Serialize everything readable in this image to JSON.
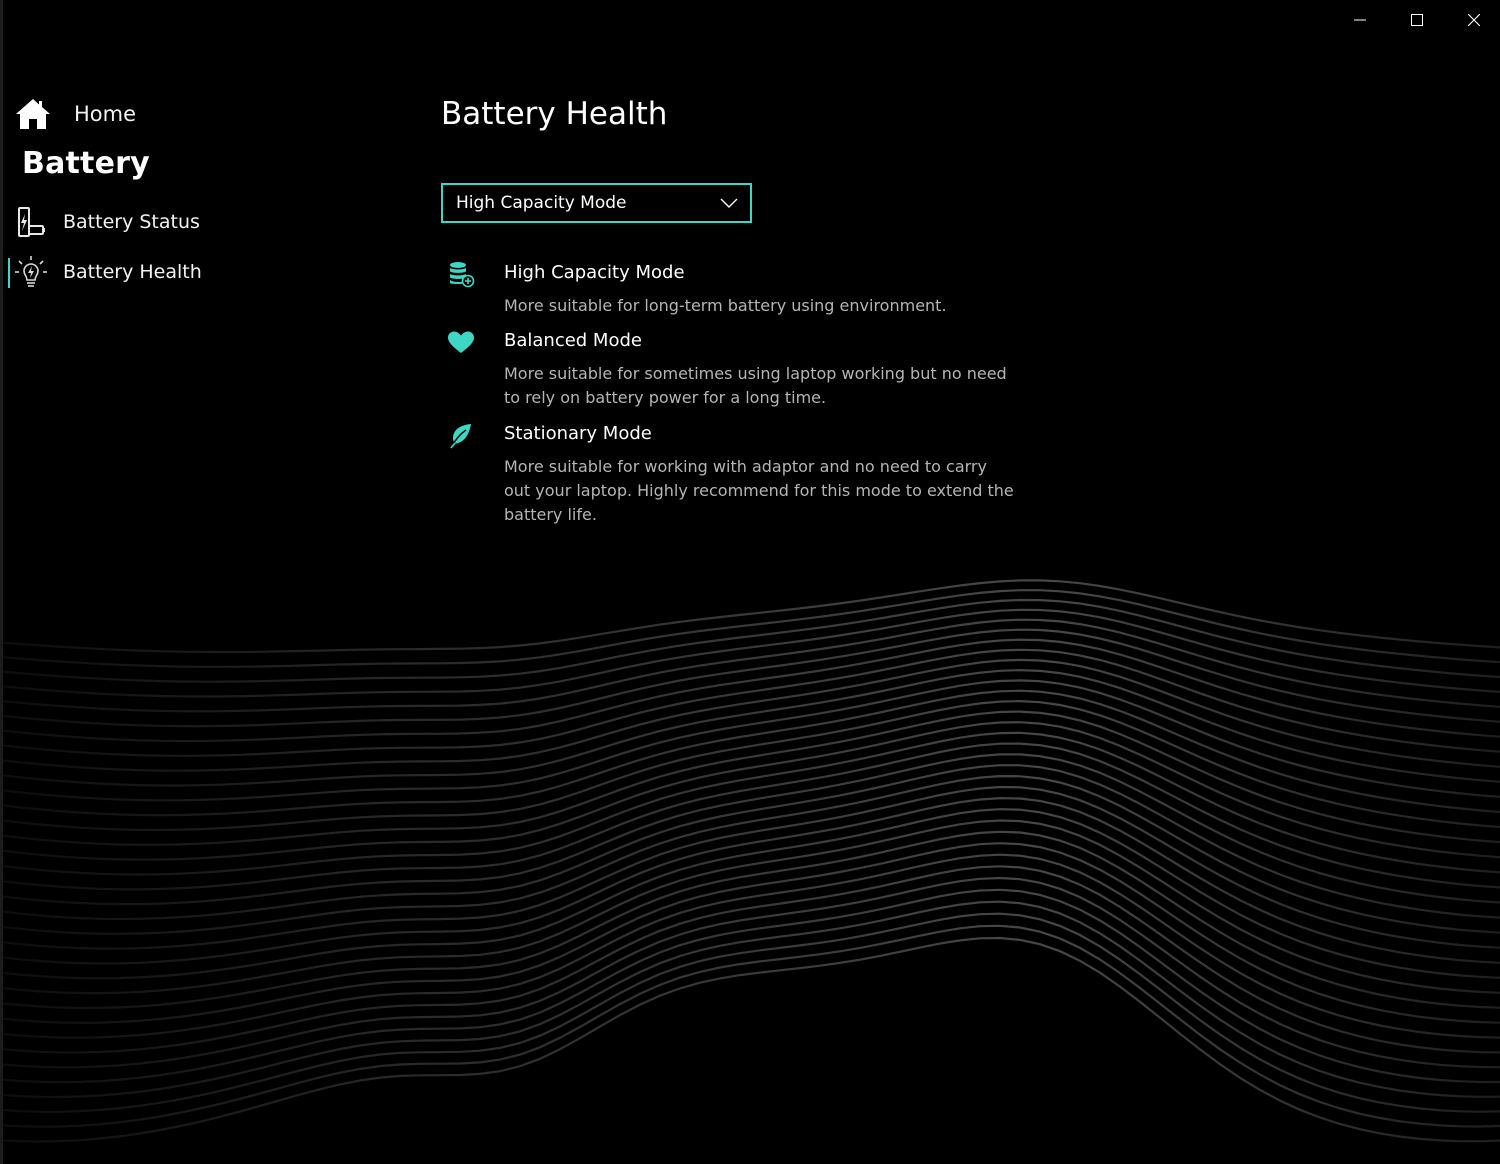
{
  "window": {
    "minimize_icon": "minimize-icon",
    "maximize_icon": "maximize-icon",
    "close_icon": "close-icon"
  },
  "sidebar": {
    "home": {
      "label": "Home",
      "icon": "home-icon"
    },
    "section_title": "Battery",
    "items": [
      {
        "label": "Battery Status",
        "icon": "battery-status-icon",
        "active": false
      },
      {
        "label": "Battery Health",
        "icon": "battery-health-icon",
        "active": true
      }
    ]
  },
  "main": {
    "title": "Battery Health",
    "dropdown": {
      "selected": "High Capacity Mode"
    },
    "modes": [
      {
        "title": "High Capacity Mode",
        "description": "More suitable for long-term battery using environment.",
        "icon": "database-plus-icon"
      },
      {
        "title": "Balanced Mode",
        "description": "More suitable for sometimes using laptop working but no need to rely on battery power for a long time.",
        "icon": "heart-icon"
      },
      {
        "title": "Stationary Mode",
        "description": "More suitable for working with adaptor and no need to carry out your laptop. Highly recommend for this mode to extend the battery life.",
        "icon": "leaf-icon"
      }
    ]
  },
  "colors": {
    "accent": "#3ed7c5",
    "background": "#000000",
    "text": "#ffffff",
    "secondary_text": "#b5b5b5"
  }
}
